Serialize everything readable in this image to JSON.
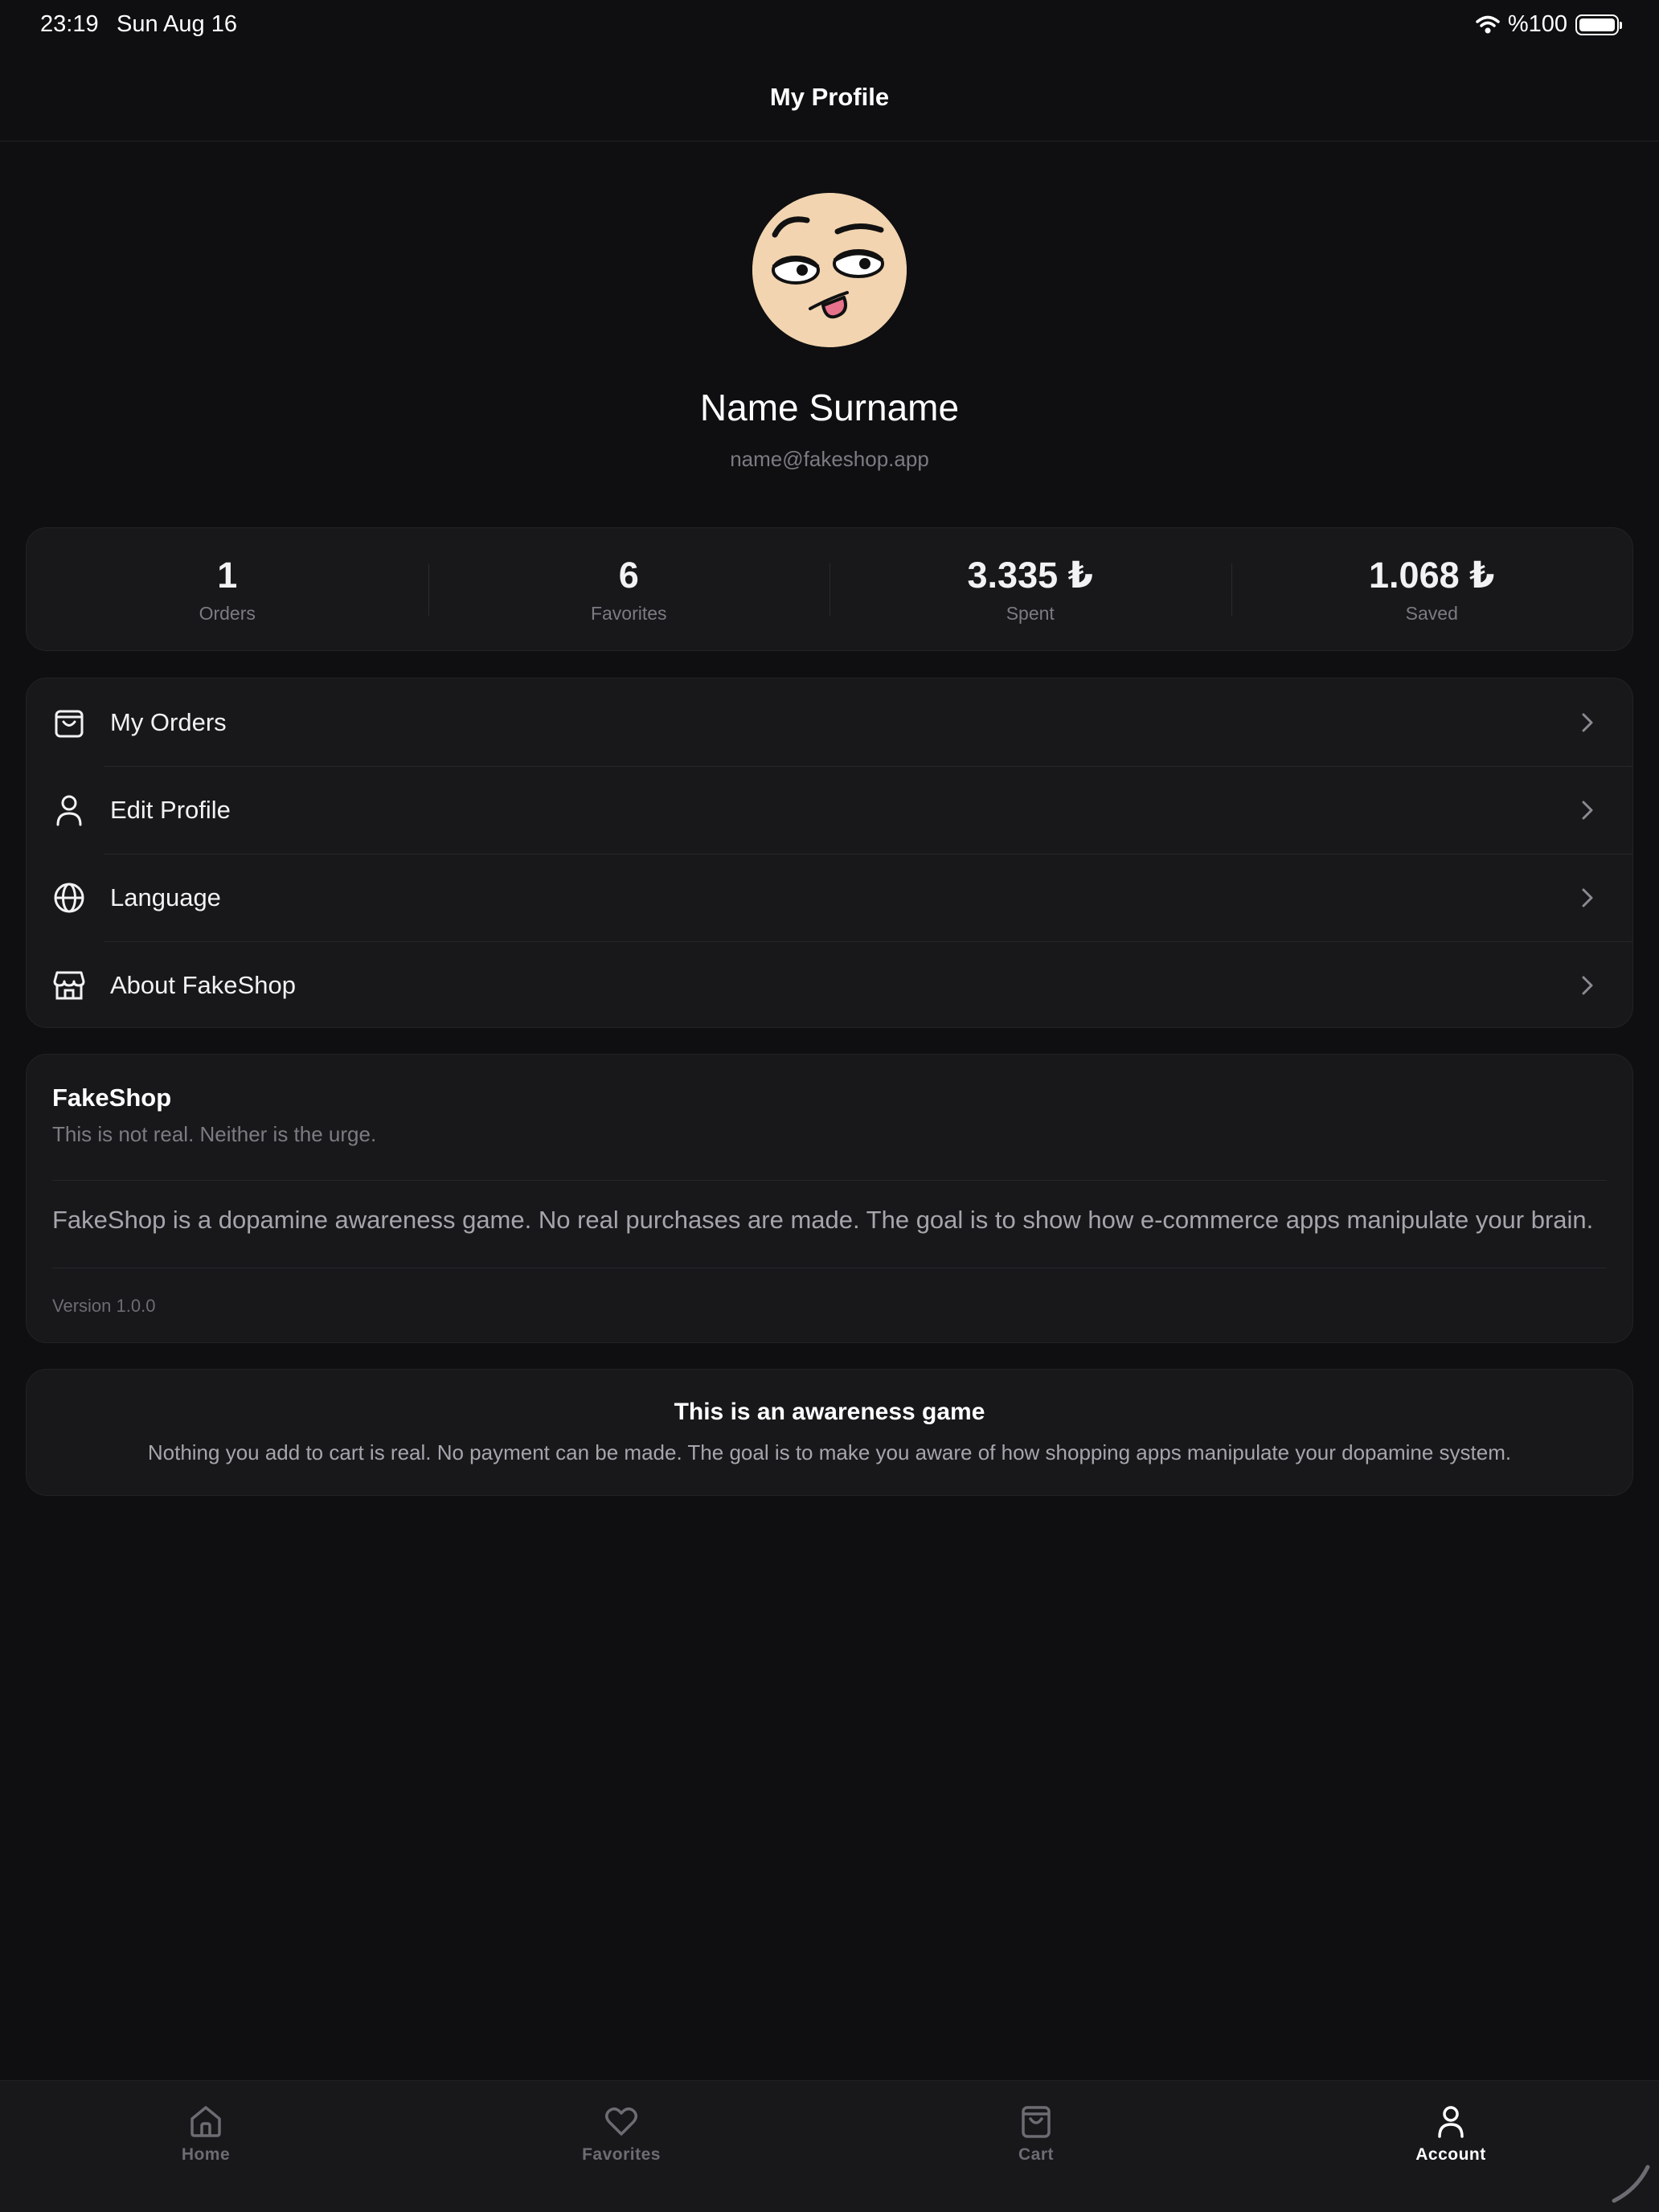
{
  "status_bar": {
    "time": "23:19",
    "date": "Sun Aug 16",
    "battery_text": "%100"
  },
  "header": {
    "title": "My Profile"
  },
  "profile": {
    "name": "Name Surname",
    "email": "name@fakeshop.app"
  },
  "stats": [
    {
      "value": "1",
      "label": "Orders"
    },
    {
      "value": "6",
      "label": "Favorites"
    },
    {
      "value": "3.335 ₺",
      "label": "Spent"
    },
    {
      "value": "1.068 ₺",
      "label": "Saved"
    }
  ],
  "menu": [
    {
      "label": "My Orders",
      "icon": "shopping-bag-icon"
    },
    {
      "label": "Edit Profile",
      "icon": "user-icon"
    },
    {
      "label": "Language",
      "icon": "globe-icon"
    },
    {
      "label": "About FakeShop",
      "icon": "store-icon"
    }
  ],
  "info": {
    "title": "FakeShop",
    "subtitle": "This is not real. Neither is the urge.",
    "description": "FakeShop is a dopamine awareness game. No real purchases are made. The goal is to show how e-commerce apps manipulate your brain.",
    "version": "Version 1.0.0"
  },
  "awareness": {
    "title": "This is an awareness game",
    "text": "Nothing you add to cart is real. No payment can be made. The goal is to make you aware of how shopping apps manipulate your dopamine system."
  },
  "tabs": [
    {
      "label": "Home",
      "icon": "home-icon",
      "active": false
    },
    {
      "label": "Favorites",
      "icon": "heart-icon",
      "active": false
    },
    {
      "label": "Cart",
      "icon": "cart-bag-icon",
      "active": false
    },
    {
      "label": "Account",
      "icon": "user-icon",
      "active": true
    }
  ],
  "colors": {
    "background": "#0f0f11",
    "card": "#18181b",
    "muted_text": "#7b7b82",
    "avatar_skin": "#f2d4b0"
  }
}
